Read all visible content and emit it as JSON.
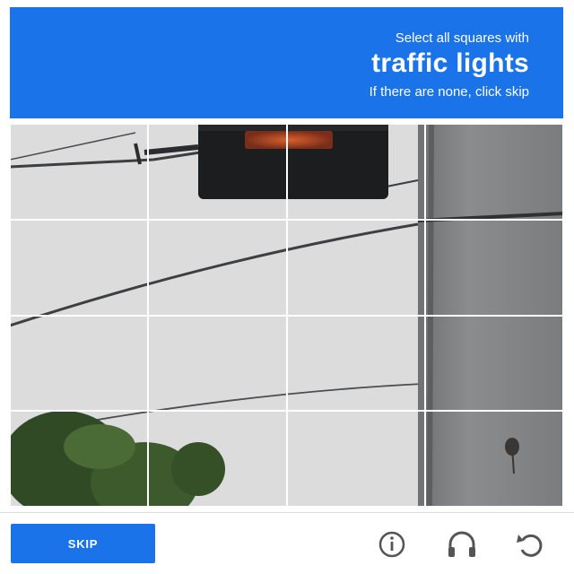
{
  "header": {
    "instruction_line1": "Select all squares with",
    "target_object": "traffic lights",
    "instruction_line3": "If there are none, click skip"
  },
  "grid": {
    "rows": 4,
    "columns": 4,
    "image_description_icon": "traffic-light-photo"
  },
  "footer": {
    "skip_label": "SKIP",
    "icons": [
      "info-icon",
      "headphones-icon",
      "reload-icon"
    ]
  },
  "colors": {
    "accent": "#1a73e8",
    "grid_line": "#ffffff"
  }
}
